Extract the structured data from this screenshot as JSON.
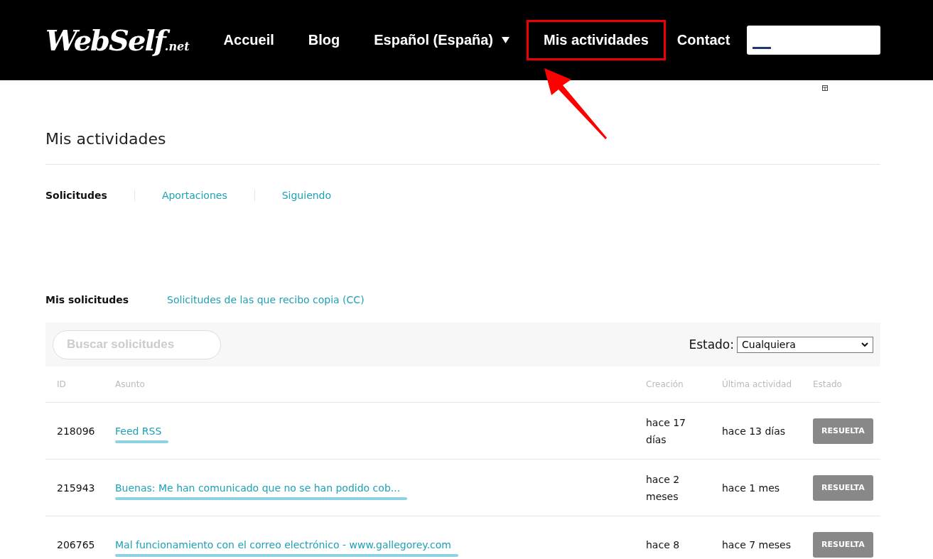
{
  "header": {
    "logo": "WebSelf",
    "logo_suffix": ".net",
    "nav": [
      {
        "label": "Accueil",
        "highlighted": false,
        "dropdown": false
      },
      {
        "label": "Blog",
        "highlighted": false,
        "dropdown": false
      },
      {
        "label": "Español (España)",
        "highlighted": false,
        "dropdown": true
      },
      {
        "label": "Mis actividades",
        "highlighted": true,
        "dropdown": false
      },
      {
        "label": "Contact",
        "highlighted": false,
        "dropdown": false
      }
    ]
  },
  "page_title": "Mis actividades",
  "tabs": [
    {
      "label": "Solicitudes",
      "selected": true
    },
    {
      "label": "Aportaciones",
      "selected": false
    },
    {
      "label": "Siguiendo",
      "selected": false
    }
  ],
  "subtabs": [
    {
      "label": "Mis solicitudes",
      "selected": true
    },
    {
      "label": "Solicitudes de las que recibo copia (CC)",
      "selected": false
    }
  ],
  "search": {
    "placeholder": "Buscar solicitudes"
  },
  "filter": {
    "label": "Estado:",
    "value": "Cualquiera"
  },
  "table": {
    "columns": [
      "ID",
      "Asunto",
      "Creación",
      "Última actividad",
      "Estado"
    ],
    "rows": [
      {
        "id": "218096",
        "subject": "Feed RSS",
        "created": "hace 17 días",
        "last_activity": "hace 13 días",
        "status": "RESUELTA"
      },
      {
        "id": "215943",
        "subject": "Buenas: Me han comunicado que no se han podido cob...",
        "created": "hace 2 meses",
        "last_activity": "hace 1 mes",
        "status": "RESUELTA"
      },
      {
        "id": "206765",
        "subject": "Mal funcionamiento con el correo electrónico - www.gallegorey.com",
        "created": "hace 8",
        "last_activity": "hace 7 meses",
        "status": "RESUELTA"
      }
    ]
  }
}
